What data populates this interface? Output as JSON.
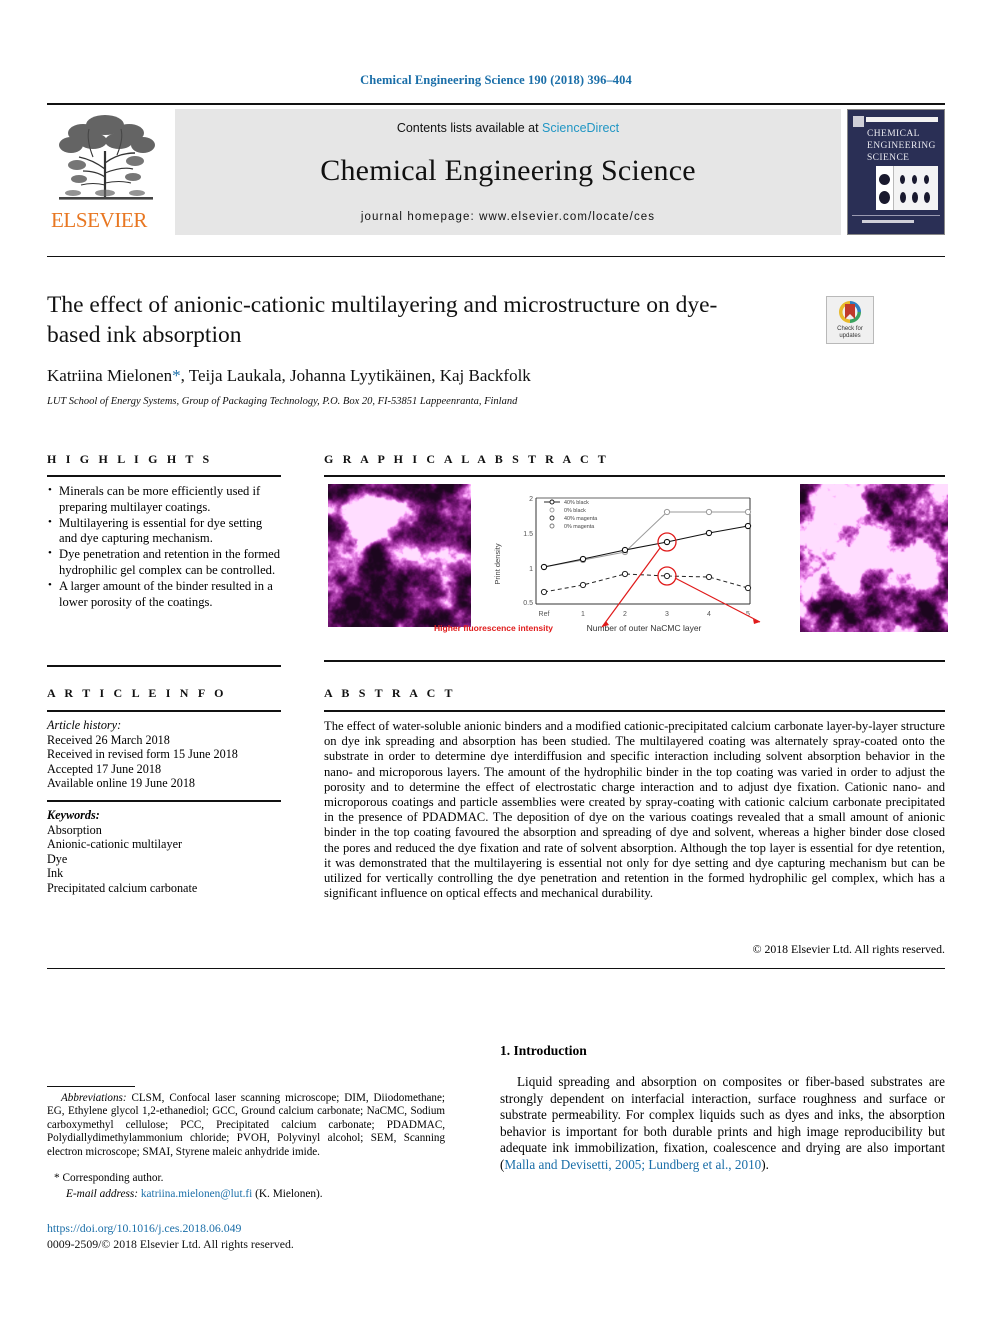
{
  "running_head": "Chemical Engineering Science 190 (2018) 396–404",
  "masthead": {
    "contents_prefix": "Contents lists available at ",
    "sciencedirect": "ScienceDirect",
    "journal_name": "Chemical Engineering Science",
    "homepage": "journal homepage: www.elsevier.com/locate/ces",
    "publisher": "ELSEVIER",
    "cover_title_lines": [
      "CHEMICAL",
      "ENGINEERING",
      "SCIENCE"
    ]
  },
  "article": {
    "title": "The effect of anionic-cationic multilayering and microstructure on dye-based ink absorption",
    "authors": "Katriina Mielonen",
    "authors_rest": ", Teija Laukala, Johanna Lyytikäinen, Kaj Backfolk",
    "corresponding_marker": "*",
    "affiliation": "LUT School of Energy Systems, Group of Packaging Technology, P.O. Box 20, FI-53851 Lappeenranta, Finland",
    "crossmark_label_1": "Check for",
    "crossmark_label_2": "updates"
  },
  "highlights": {
    "heading": "H I G H L I G H T S",
    "items": [
      "Minerals can be more efficiently used if preparing multilayer coatings.",
      "Multilayering is essential for dye setting and dye capturing mechanism.",
      "Dye penetration and retention in the formed hydrophilic gel complex can be controlled.",
      "A larger amount of the binder resulted in a lower porosity of the coatings."
    ]
  },
  "article_info": {
    "heading": "A R T I C L E   I N F O",
    "history_label": "Article history:",
    "history": [
      "Received 26 March 2018",
      "Received in revised form 15 June 2018",
      "Accepted 17 June 2018",
      "Available online 19 June 2018"
    ],
    "keywords_label": "Keywords:",
    "keywords": [
      "Absorption",
      "Anionic-cationic multilayer",
      "Dye",
      "Ink",
      "Precipitated calcium carbonate"
    ]
  },
  "graphical_abstract": {
    "heading": "G R A P H I C A L   A B S T R A C T",
    "caption": "Higher fluorescence intensity",
    "left_image_name": "clsm-micrograph-left",
    "right_image_name": "clsm-micrograph-right"
  },
  "chart_data": {
    "type": "line",
    "title": "",
    "xlabel": "Number of outer NaCMC layer",
    "ylabel": "Print density",
    "x": [
      "Ref",
      1,
      2,
      3,
      4,
      5
    ],
    "xlim": [
      0,
      5
    ],
    "ylim": [
      0.5,
      2
    ],
    "yticks": [
      0.5,
      1,
      1.5,
      2
    ],
    "grid": false,
    "legend_position": "top-left",
    "series": [
      {
        "name": "40% black",
        "values": [
          1.19,
          1.3,
          1.38,
          1.42,
          1.52,
          1.6
        ]
      },
      {
        "name": "0% black",
        "values": [
          1.19,
          1.3,
          1.38,
          1.78,
          1.77,
          1.77
        ]
      },
      {
        "name": "40% magenta",
        "values": [
          0.83,
          0.92,
          1.02,
          1.0,
          0.99,
          0.88
        ]
      },
      {
        "name": "0% magenta",
        "values": [
          0.83,
          0.92,
          1.02,
          1.0,
          0.99,
          0.88
        ]
      }
    ],
    "annotations": [
      "Higher fluorescence intensity"
    ]
  },
  "abstract": {
    "heading": "A B S T R A C T",
    "text": "The effect of water-soluble anionic binders and a modified cationic-precipitated calcium carbonate layer-by-layer structure on dye ink spreading and absorption has been studied. The multilayered coating was alternately spray-coated onto the substrate in order to determine dye interdiffusion and specific interaction including solvent absorption behavior in the nano- and microporous layers. The amount of the hydrophilic binder in the top coating was varied in order to adjust the porosity and to determine the effect of electrostatic charge interaction and to adjust dye fixation. Cationic nano- and microporous coatings and particle assemblies were created by spray-coating with cationic calcium carbonate precipitated in the presence of PDADMAC. The deposition of dye on the various coatings revealed that a small amount of anionic binder in the top coating favoured the absorption and spreading of dye and solvent, whereas a higher binder dose closed the pores and reduced the dye fixation and rate of solvent absorption. Although the top layer is essential for dye retention, it was demonstrated that the multilayering is essential not only for dye setting and dye capturing mechanism but can be utilized for vertically controlling the dye penetration and retention in the formed hydrophilic gel complex, which has a significant influence on optical effects and mechanical durability.",
    "copyright": "© 2018 Elsevier Ltd. All rights reserved."
  },
  "introduction": {
    "heading": "1. Introduction",
    "paragraph_1": "Liquid spreading and absorption on composites or fiber-based substrates are strongly dependent on interfacial interaction, surface roughness and surface or substrate permeability. For complex liquids such as dyes and inks, the absorption behavior is important for both durable prints and high image reproducibility but adequate ink immobilization, fixation, coalescence and drying are also important (",
    "citation": "Malla and Devisetti, 2005; Lundberg et al., 2010",
    "paragraph_1_end": ")."
  },
  "footnotes": {
    "abbreviations_label": "Abbreviations:",
    "abbreviations_text": " CLSM, Confocal laser scanning microscope; DIM, Diiodomethane; EG, Ethylene glycol 1,2-ethanediol; GCC, Ground calcium carbonate; NaCMC, Sodium carboxymethyl cellulose; PCC, Precipitated calcium carbonate; PDADMAC, Polydiallydimethylammonium chloride; PVOH, Polyvinyl alcohol; SEM, Scanning electron microscope; SMAI, Styrene maleic anhydride imide.",
    "corresponding": "* Corresponding author.",
    "email_label": "E-mail address:",
    "email": "katriina.mielonen@lut.fi",
    "email_suffix": " (K. Mielonen).",
    "doi": "https://doi.org/10.1016/j.ces.2018.06.049",
    "issn": "0009-2509/© 2018 Elsevier Ltd. All rights reserved."
  },
  "colors": {
    "link_blue": "#1a6ea8",
    "sciencedirect_blue": "#2196c4",
    "elsevier_orange": "#E87722",
    "annotation_red": "#e01b1b",
    "band_gray": "#e6e6e6",
    "cover_navy": "#2a2f55"
  }
}
